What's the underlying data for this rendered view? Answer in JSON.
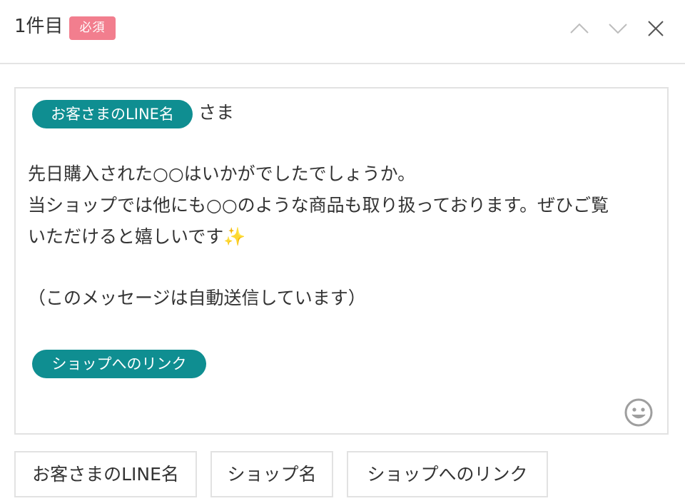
{
  "header": {
    "title": "1件目",
    "required_badge": "必須"
  },
  "editor": {
    "tag_customer_name": "お客さまのLINE名",
    "salutation": "さま",
    "lines": [
      "先日購入された○○はいかがでしたでしょうか。",
      "当ショップでは他にも○○のような商品も取り扱っております。ぜひご覧",
      "いただけると嬉しいです",
      "（このメッセージは自動送信しています）"
    ],
    "sparkle": "✨",
    "tag_shop_link": "ショップへのリンク"
  },
  "insert_buttons": {
    "customer_name": "お客さまのLINE名",
    "shop_name": "ショップ名",
    "shop_link": "ショップへのリンク"
  },
  "colors": {
    "tag_bg": "#0f8e91",
    "badge_bg": "#f27e8e"
  },
  "icons": [
    "chevron-up-icon",
    "chevron-down-icon",
    "close-icon",
    "emoji-icon"
  ]
}
